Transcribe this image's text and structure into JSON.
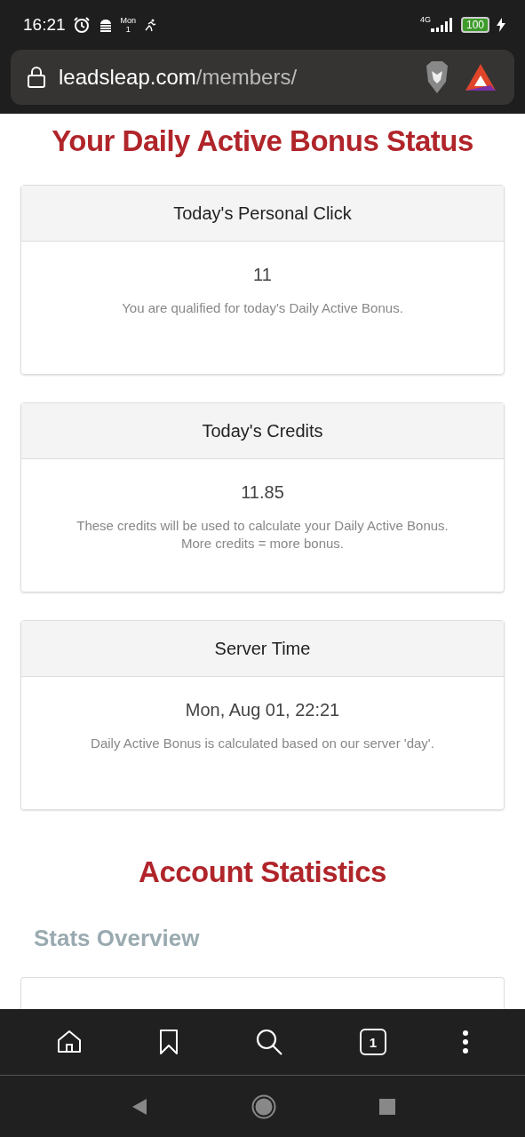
{
  "status_bar": {
    "time": "16:21",
    "calendar_day": "Mon",
    "calendar_date": "1",
    "network": "4G",
    "battery": "100"
  },
  "address_bar": {
    "host": "leadsleap.com",
    "path": "/members/"
  },
  "page": {
    "title": "Your Daily Active Bonus Status",
    "cards": [
      {
        "header": "Today's Personal Click",
        "value": "11",
        "notes": [
          "You are qualified for today's Daily Active Bonus."
        ]
      },
      {
        "header": "Today's Credits",
        "value": "11.85",
        "notes": [
          "These credits will be used to calculate your Daily Active Bonus.",
          "More credits = more bonus."
        ]
      },
      {
        "header": "Server Time",
        "value": "Mon, Aug 01, 22:21",
        "notes": [
          "Daily Active Bonus is calculated based on our server 'day'."
        ]
      }
    ],
    "section_title": "Account Statistics",
    "subsection_title": "Stats Overview"
  },
  "toolbar": {
    "tab_count": "1"
  }
}
